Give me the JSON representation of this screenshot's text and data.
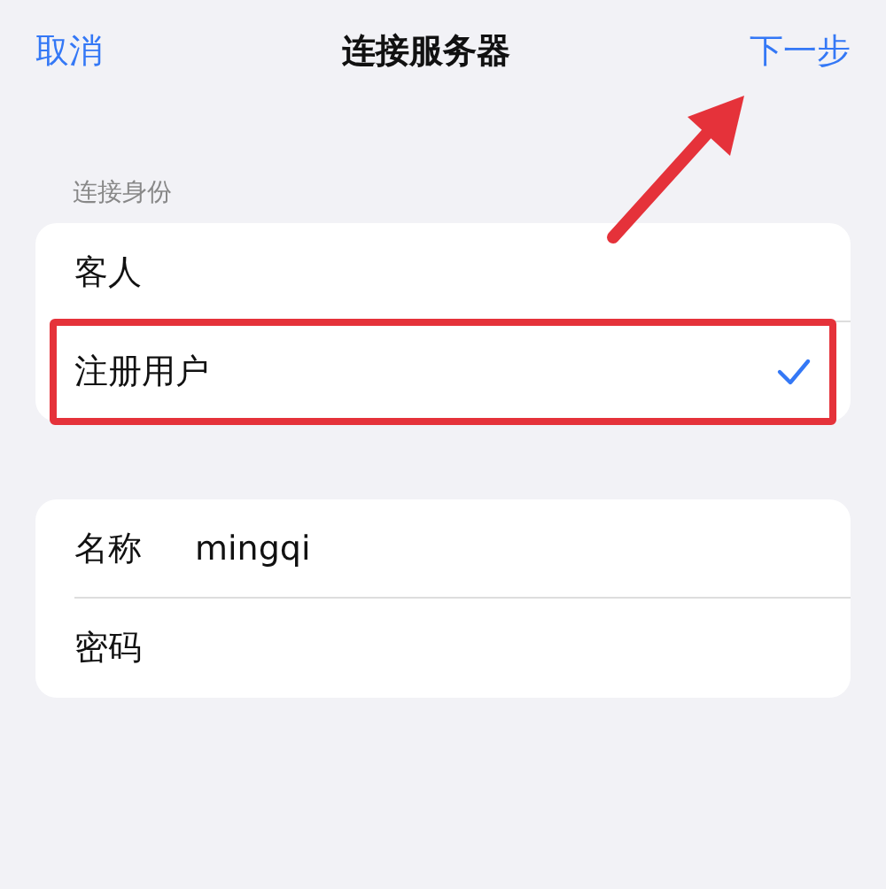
{
  "nav": {
    "cancel": "取消",
    "title": "连接服务器",
    "next": "下一步"
  },
  "identity": {
    "label": "连接身份",
    "options": [
      {
        "label": "客人",
        "selected": false
      },
      {
        "label": "注册用户",
        "selected": true
      }
    ]
  },
  "fields": [
    {
      "label": "名称",
      "value": "mingqi"
    },
    {
      "label": "密码"
    }
  ]
}
